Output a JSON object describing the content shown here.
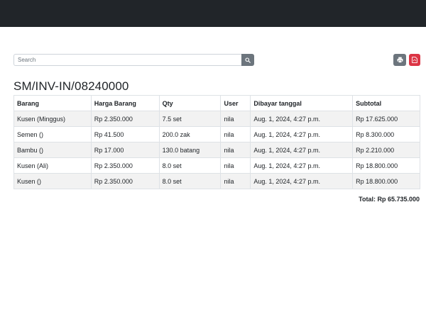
{
  "search": {
    "placeholder": "Search"
  },
  "icons": {
    "search": "search-icon",
    "print": "print-icon",
    "pdf": "file-pdf-icon"
  },
  "colors": {
    "navbar": "#212529",
    "secondary_button": "#6c757d",
    "danger_button": "#dc3545"
  },
  "invoice": {
    "number": "SM/INV-IN/08240000",
    "columns": [
      "Barang",
      "Harga Barang",
      "Qty",
      "User",
      "Dibayar tanggal",
      "Subtotal"
    ],
    "rows": [
      [
        "Kusen (Minggus)",
        "Rp 2.350.000",
        "7.5 set",
        "nila",
        "Aug. 1, 2024, 4:27 p.m.",
        "Rp 17.625.000"
      ],
      [
        "Semen ()",
        "Rp 41.500",
        "200.0 zak",
        "nila",
        "Aug. 1, 2024, 4:27 p.m.",
        "Rp 8.300.000"
      ],
      [
        "Bambu ()",
        "Rp 17.000",
        "130.0 batang",
        "nila",
        "Aug. 1, 2024, 4:27 p.m.",
        "Rp 2.210.000"
      ],
      [
        "Kusen (Ali)",
        "Rp 2.350.000",
        "8.0 set",
        "nila",
        "Aug. 1, 2024, 4:27 p.m.",
        "Rp 18.800.000"
      ],
      [
        "Kusen ()",
        "Rp 2.350.000",
        "8.0 set",
        "nila",
        "Aug. 1, 2024, 4:27 p.m.",
        "Rp 18.800.000"
      ]
    ],
    "total": "Total: Rp 65.735.000"
  }
}
